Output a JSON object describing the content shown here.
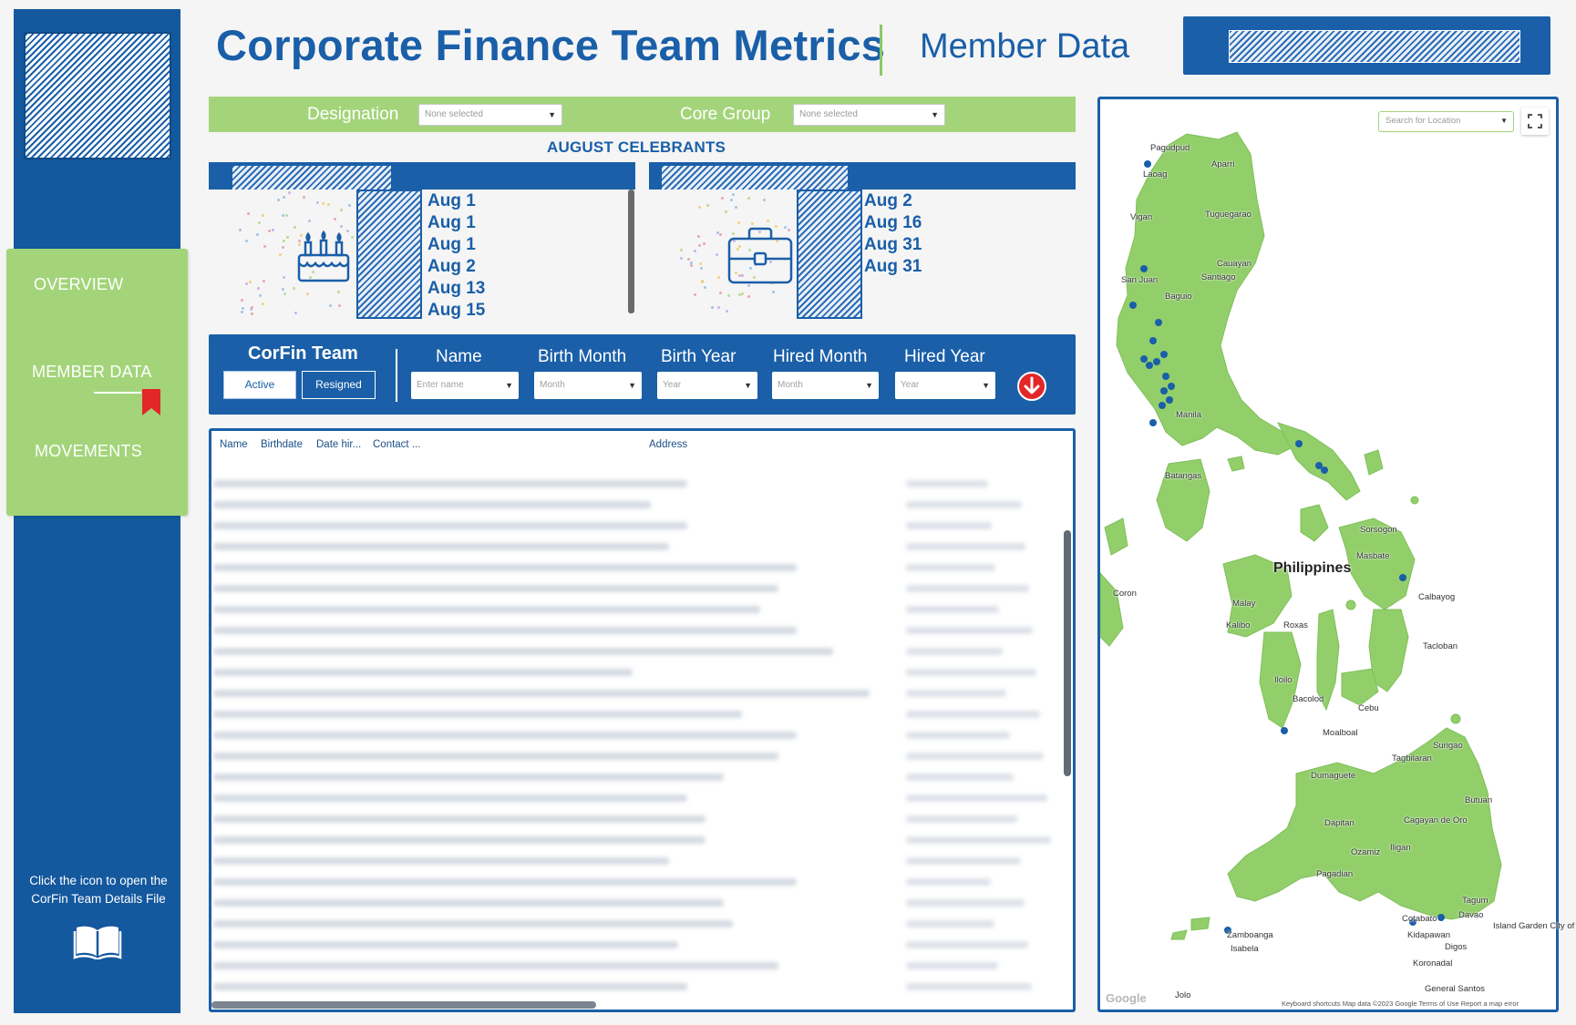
{
  "header": {
    "title": "Corporate Finance Team Metrics",
    "subtitle": "Member Data"
  },
  "sidebar": {
    "nav": [
      {
        "label": "OVERVIEW"
      },
      {
        "label": "MEMBER DATA",
        "active": true
      },
      {
        "label": "MOVEMENTS"
      }
    ],
    "note": "Click the icon to open the CorFin Team Details File",
    "icons": [
      "bookmark-icon",
      "book-icon"
    ]
  },
  "filters": {
    "designation_label": "Designation",
    "designation_value": "None selected",
    "core_group_label": "Core Group",
    "core_group_value": "None selected"
  },
  "celebrants": {
    "title": "AUGUST CELEBRANTS",
    "birthdays": [
      "Aug 1",
      "Aug 1",
      "Aug 1",
      "Aug 2",
      "Aug 13",
      "Aug 15"
    ],
    "anniversaries": [
      "Aug 2",
      "Aug 16",
      "Aug 31",
      "Aug 31"
    ],
    "icons": [
      "birthday-cake-icon",
      "briefcase-icon"
    ]
  },
  "team": {
    "title": "CorFin Team",
    "active_label": "Active",
    "resigned_label": "Resigned",
    "name_label": "Name",
    "name_placeholder": "Enter name",
    "birth_month_label": "Birth Month",
    "birth_month_placeholder": "Month",
    "birth_year_label": "Birth Year",
    "birth_year_placeholder": "Year",
    "hired_month_label": "Hired Month",
    "hired_month_placeholder": "Month",
    "hired_year_label": "Hired Year",
    "hired_year_placeholder": "Year"
  },
  "table": {
    "columns": [
      "Name",
      "Birthdate",
      "Date hir...",
      "Contact ...",
      "Address"
    ]
  },
  "map": {
    "search_placeholder": "Search for Location",
    "country": "Philippines",
    "places": [
      "Pagudpud",
      "Aparri",
      "Laoag",
      "Vigan",
      "Tuguegarao",
      "Cauayan",
      "Santiago",
      "San Juan",
      "Baguio",
      "Manila",
      "Batangas",
      "Sorsogon",
      "Masbate",
      "Coron",
      "Calbayog",
      "Malay",
      "Kalibo",
      "Roxas",
      "Tacloban",
      "Iloilo",
      "Bacolod",
      "Cebu",
      "Moalboal",
      "Surigao",
      "Tagbilaran",
      "Dumaguete",
      "Butuan",
      "Dapitan",
      "Cagayan de Oro",
      "Ozamiz",
      "Iligan",
      "Pagadian",
      "Tagum",
      "Davao",
      "Cotabato",
      "Kidapawan",
      "Island Garden City of Samal",
      "Zamboanga",
      "Isabela",
      "Digos",
      "Koronadal",
      "General Santos",
      "Jolo"
    ],
    "attribution": "Keyboard shortcuts   Map data ©2023 Google   Terms of Use   Report a map error",
    "logo": "Google"
  },
  "colors": {
    "brand_blue": "#1a5fa8",
    "accent_green": "#a3d47a",
    "land_green": "#92cf6b",
    "alert_red": "#e32628"
  }
}
